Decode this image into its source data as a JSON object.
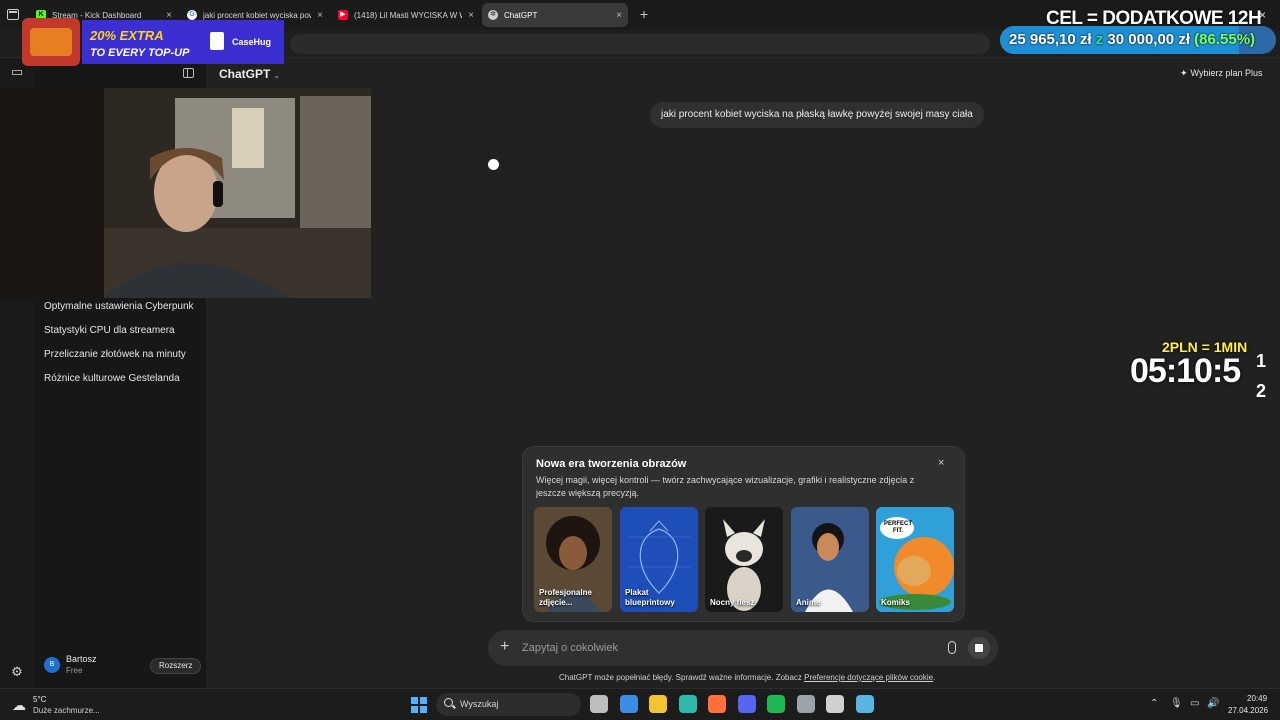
{
  "browser": {
    "tabs": [
      {
        "title": "Stream - Kick Dashboard",
        "favicon": "kick-icon",
        "color": "#53fc18",
        "active": false
      },
      {
        "title": "jaki procent kobiet wyciska pow",
        "favicon": "google-icon",
        "color": "#4285f4",
        "active": false
      },
      {
        "title": "(1418) Lil Masti WYCISKA W Wi",
        "favicon": "youtube-icon",
        "color": "#ff0033",
        "active": false
      },
      {
        "title": "ChatGPT",
        "favicon": "chatgpt-icon",
        "color": "#cccccc",
        "active": true
      }
    ],
    "new_tab": "+",
    "close": "×"
  },
  "header": {
    "model": "ChatGPT",
    "plan_link": "Wybierz plan Plus"
  },
  "sidebar": {
    "chats": [
      "Optymalne ustawienia Cyberpunk",
      "Statystyki CPU dla streamera",
      "Przeliczanie złotówek na minuty",
      "Różnice kulturowe Gestelanda"
    ],
    "user": {
      "initial": "B",
      "name": "Bartosz",
      "plan": "Free"
    },
    "expand_button": "Rozszerz"
  },
  "conversation": {
    "user_message": "jaki procent kobiet wyciska na płaską ławkę powyżej swojej masy ciała"
  },
  "promo": {
    "title": "Nowa era tworzenia obrazów",
    "description": "Więcej magii, więcej kontroli — twórz zachwycające wizualizacje, grafiki i realistyczne zdjęcia z jeszcze większą precyzją.",
    "close": "×",
    "cards": [
      {
        "label": "Profesjonalne zdjęcie...",
        "bg": "#5a4a35"
      },
      {
        "label": "Plakat blueprintowy",
        "bg": "#1e4fb8"
      },
      {
        "label": "Nocny flesz",
        "bg": "#1a1a1a"
      },
      {
        "label": "Anime",
        "bg": "#3b5a8c"
      },
      {
        "label": "Komiks",
        "bg": "#2fa0d8"
      }
    ],
    "comic_bubble": "PERFECT FIT."
  },
  "composer": {
    "placeholder": "Zapytaj o cokolwiek",
    "plus": "+"
  },
  "disclaimer": {
    "text": "ChatGPT może popełniać błędy. Sprawdź ważne informacje. Zobacz ",
    "link": "Preferencje dotyczące plików cookie",
    "end": "."
  },
  "overlay": {
    "ad_line1": "20% EXTRA",
    "ad_line2": "TO EVERY TOP-UP",
    "ad_brand": "CaseHug",
    "goal_title": "CEL = DODATKOWE 12H",
    "goal_current": "25 965,10 zł",
    "goal_sep": "z",
    "goal_target": "30 000,00 zł",
    "goal_percent": "(86.55%)",
    "goal_fraction": 0.8655,
    "rate": "2PLN = 1MIN",
    "timer": "05:10:5",
    "timer_extra": "1 2"
  },
  "taskbar": {
    "weather_temp": "5°C",
    "weather_desc": "Duże zachmurze...",
    "search": "Wyszukaj",
    "time": "20:49",
    "date": "27.04.2026",
    "apps": [
      {
        "name": "task-view-icon",
        "color": "#bdbdbd"
      },
      {
        "name": "store-icon",
        "color": "#3a8ee6"
      },
      {
        "name": "file-explorer-icon",
        "color": "#f4c430"
      },
      {
        "name": "edge-icon",
        "color": "#2bbbad"
      },
      {
        "name": "firefox-icon",
        "color": "#ff7139"
      },
      {
        "name": "discord-icon",
        "color": "#5865f2"
      },
      {
        "name": "spotify-icon",
        "color": "#1db954"
      },
      {
        "name": "settings-icon",
        "color": "#9aa4ad"
      },
      {
        "name": "obs-icon",
        "color": "#d0d0d0"
      },
      {
        "name": "notepad-icon",
        "color": "#58b4e0"
      }
    ]
  }
}
